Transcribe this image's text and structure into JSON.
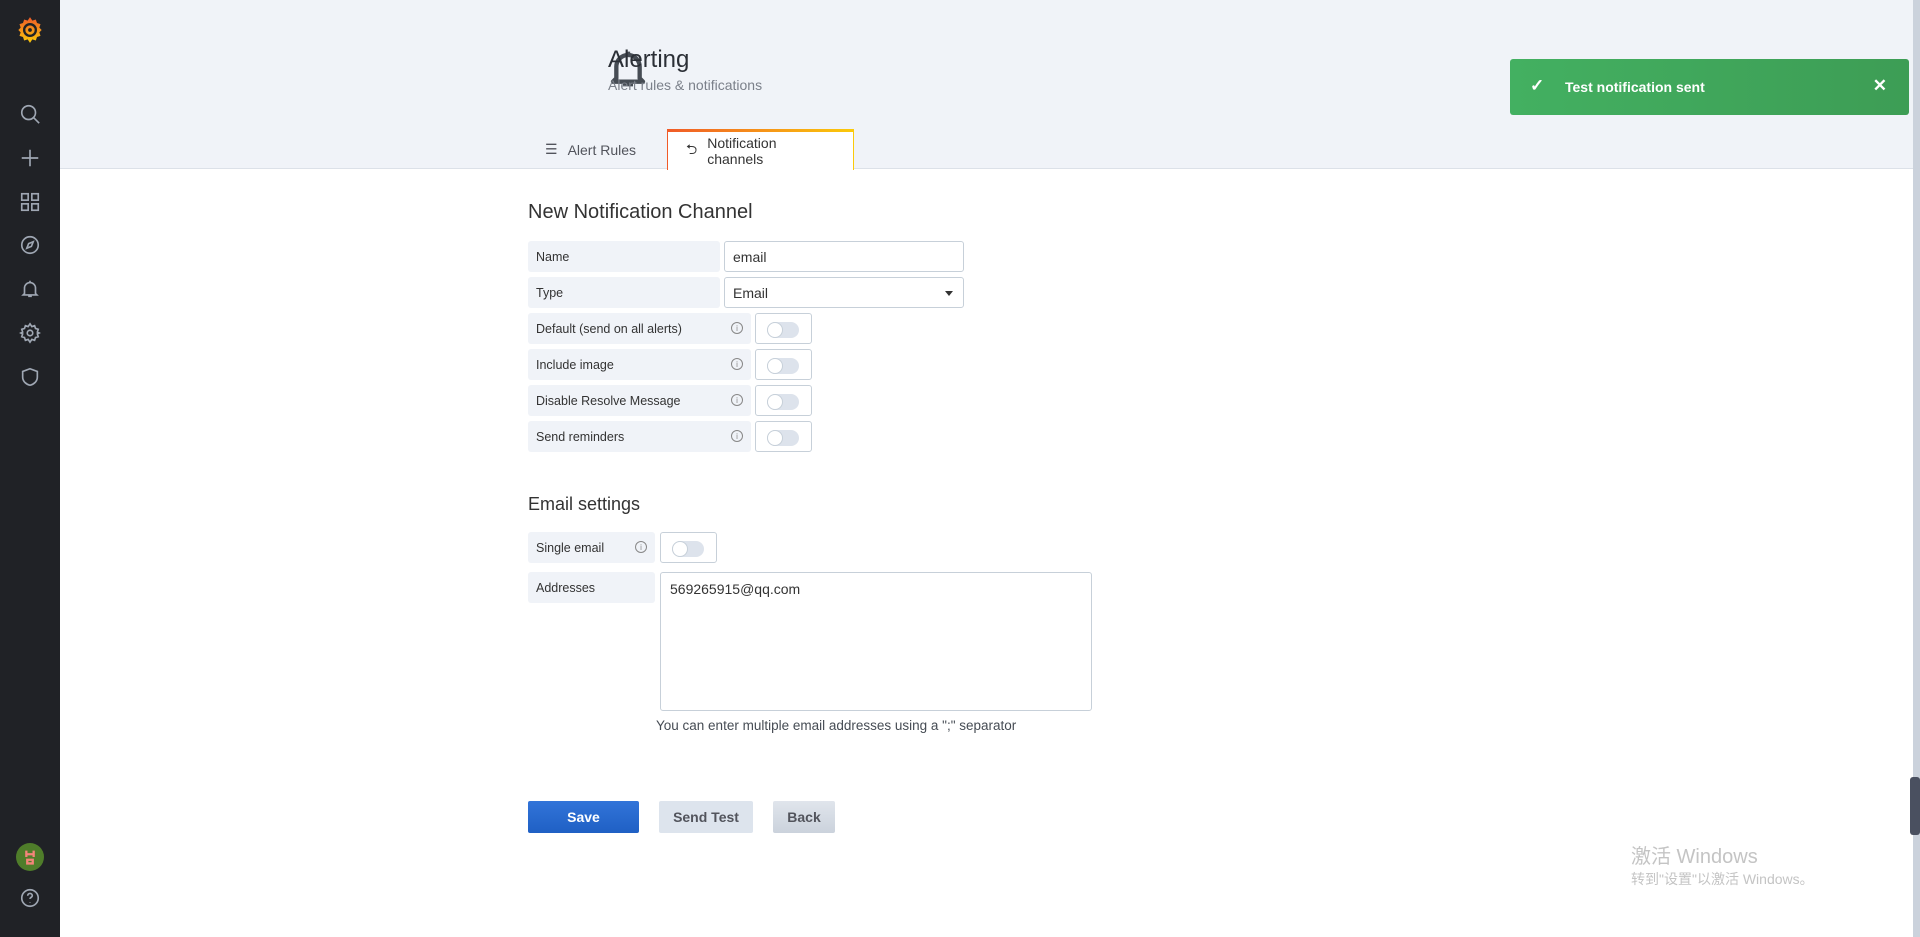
{
  "sidebar": {
    "items": [
      "search",
      "create",
      "dashboards",
      "explore",
      "alerting",
      "configuration",
      "server-admin"
    ],
    "bottom": [
      "profile",
      "help"
    ]
  },
  "header": {
    "title": "Alerting",
    "subtitle": "Alert rules & notifications",
    "tabs": [
      {
        "label": "Alert Rules",
        "active": false
      },
      {
        "label": "Notification channels",
        "active": true
      }
    ]
  },
  "form": {
    "heading": "New Notification Channel",
    "name": {
      "label": "Name",
      "value": "email"
    },
    "type": {
      "label": "Type",
      "value": "Email"
    },
    "toggles": [
      {
        "label": "Default (send on all alerts)",
        "on": false
      },
      {
        "label": "Include image",
        "on": false
      },
      {
        "label": "Disable Resolve Message",
        "on": false
      },
      {
        "label": "Send reminders",
        "on": false
      }
    ]
  },
  "email": {
    "heading": "Email settings",
    "single": {
      "label": "Single email",
      "on": false
    },
    "addresses": {
      "label": "Addresses",
      "value": "569265915@qq.com"
    },
    "help": "You can enter multiple email addresses using a \";\" separator"
  },
  "buttons": {
    "save": "Save",
    "test": "Send Test",
    "back": "Back"
  },
  "toast": {
    "text": "Test notification sent",
    "color": "#3fa95b"
  },
  "watermark": {
    "line1": "激活 Windows",
    "line2": "转到\"设置\"以激活 Windows。"
  },
  "colors": {
    "primary": "#2f6fd3",
    "sidebar": "#202226"
  }
}
